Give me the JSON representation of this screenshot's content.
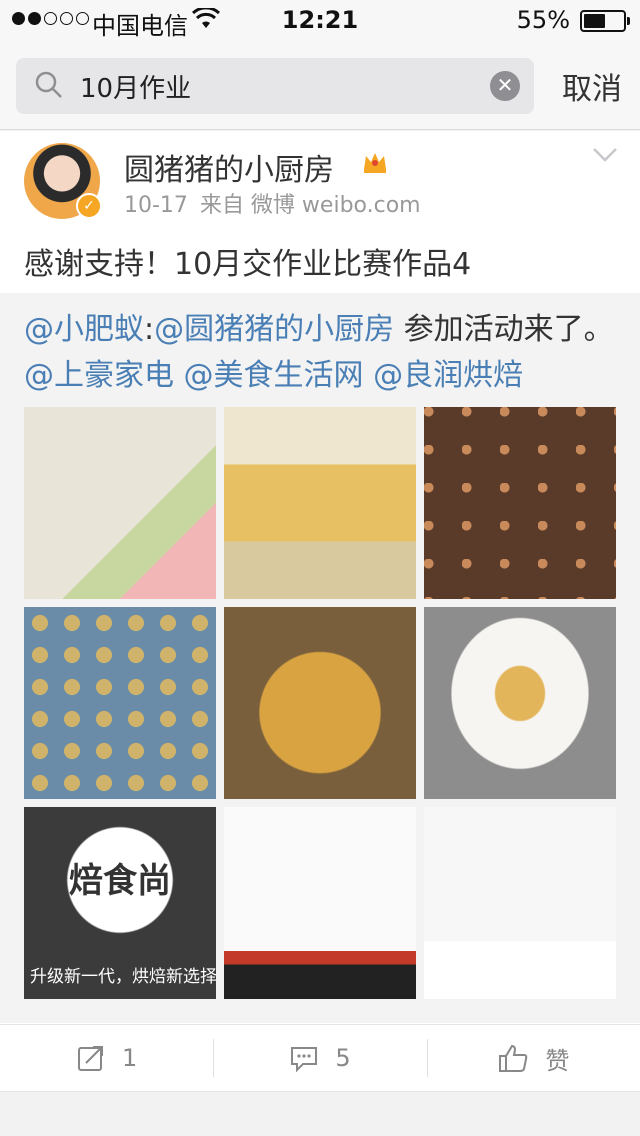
{
  "status_bar": {
    "carrier": "中国电信",
    "time": "12:21",
    "battery_percent": "55%",
    "battery_level": 0.55,
    "signal_strength": 2
  },
  "search": {
    "query": "10月作业",
    "cancel_label": "取消"
  },
  "post": {
    "user_name": "圆猪猪的小厨房",
    "date": "10-17",
    "source": "来自 微博 weibo.com",
    "text": "感谢支持！10月交作业比赛作品4",
    "repost": {
      "author": "@小肥蚁",
      "colon": ":",
      "mention_1": "@圆猪猪的小厨房",
      "text_1": " 参加活动来了。",
      "mention_2": "@上豪家电",
      "mention_3": "@美食生活网",
      "mention_4": "@良润烘焙"
    },
    "images": {
      "count": 9,
      "image_7_logo": "焙食尚",
      "image_7_caption": "升级新一代，烘焙新选择"
    }
  },
  "actions": {
    "repost_count": "1",
    "comment_count": "5",
    "like_label": "赞"
  }
}
